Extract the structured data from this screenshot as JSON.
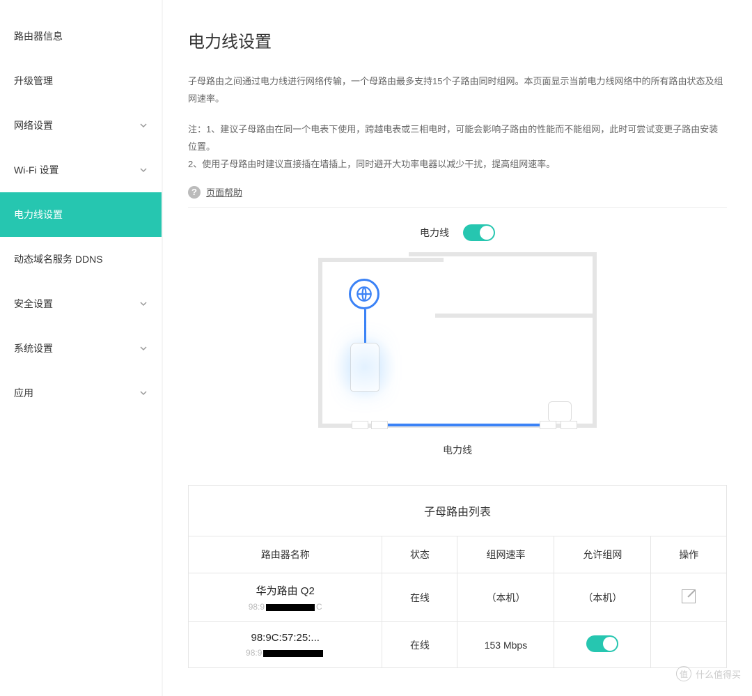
{
  "sidebar": {
    "items": [
      {
        "label": "路由器信息",
        "expandable": false
      },
      {
        "label": "升级管理",
        "expandable": false
      },
      {
        "label": "网络设置",
        "expandable": true
      },
      {
        "label": "Wi-Fi 设置",
        "expandable": true
      },
      {
        "label": "电力线设置",
        "expandable": false,
        "active": true
      },
      {
        "label": "动态域名服务 DDNS",
        "expandable": false
      },
      {
        "label": "安全设置",
        "expandable": true
      },
      {
        "label": "系统设置",
        "expandable": true
      },
      {
        "label": "应用",
        "expandable": true
      }
    ]
  },
  "page": {
    "title": "电力线设置",
    "description": "子母路由之间通过电力线进行网络传输，一个母路由最多支持15个子路由同时组网。本页面显示当前电力线网络中的所有路由状态及组网速率。",
    "note": "注：1、建议子母路由在同一个电表下使用，跨越电表或三相电时，可能会影响子路由的性能而不能组网，此时可尝试变更子路由安装位置。\n2、使用子母路由时建议直接插在墙插上，同时避开大功率电器以减少干扰，提高组网速率。",
    "help_link": "页面帮助",
    "toggle_label": "电力线",
    "diagram_caption": "电力线"
  },
  "table": {
    "title": "子母路由列表",
    "columns": {
      "name": "路由器名称",
      "status": "状态",
      "speed": "组网速率",
      "allow": "允许组网",
      "op": "操作"
    },
    "rows": [
      {
        "name": "华为路由 Q2",
        "mac_prefix": "98:9",
        "mac_suffix": "C",
        "status": "在线",
        "speed": "（本机）",
        "allow": "（本机）",
        "editable": true
      },
      {
        "name": "98:9C:57:25:...",
        "mac_prefix": "98:9",
        "mac_suffix": "",
        "status": "在线",
        "speed": "153 Mbps",
        "allow_toggle": true
      }
    ]
  },
  "watermark": {
    "text": "什么值得买",
    "icon": "值"
  }
}
